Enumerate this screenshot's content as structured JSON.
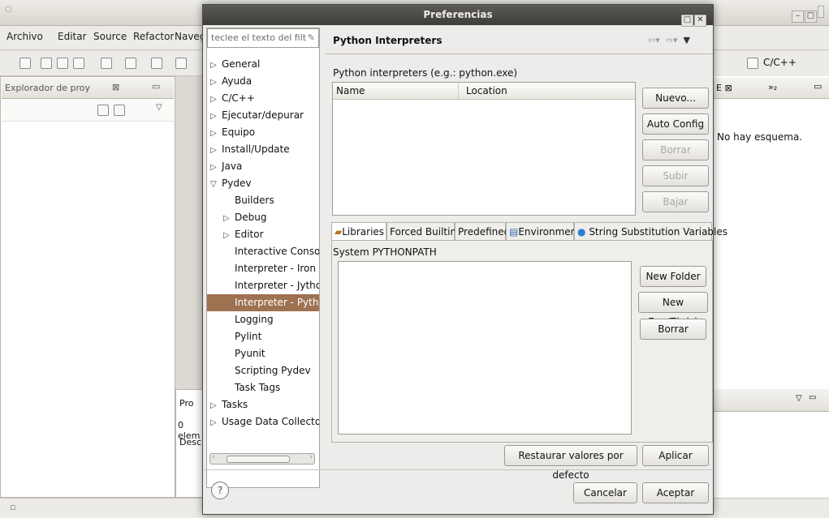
{
  "background": {
    "window_control_glyph": "○",
    "menubar": [
      "Archivo",
      "Editar",
      "Source",
      "Refactor",
      "Naveg"
    ],
    "left_view": {
      "tab_label": "Explorador de proy",
      "tab_close": "⊠"
    },
    "right_view": {
      "tab_label": "E ⊠",
      "tab_overflow": "»₂",
      "text": "No hay esquema."
    },
    "perspective": {
      "label": "C/C++"
    },
    "bottom_left": {
      "tab_label": "Pro",
      "count_text": "0 elem",
      "column": "Descr"
    }
  },
  "dialog": {
    "title": "Preferencias",
    "filter_placeholder": "teclee el texto del filt",
    "tree": [
      {
        "label": "General",
        "expander": "▷",
        "level": 0
      },
      {
        "label": "Ayuda",
        "expander": "▷",
        "level": 0
      },
      {
        "label": "C/C++",
        "expander": "▷",
        "level": 0
      },
      {
        "label": "Ejecutar/depurar",
        "expander": "▷",
        "level": 0
      },
      {
        "label": "Equipo",
        "expander": "▷",
        "level": 0
      },
      {
        "label": "Install/Update",
        "expander": "▷",
        "level": 0
      },
      {
        "label": "Java",
        "expander": "▷",
        "level": 0
      },
      {
        "label": "Pydev",
        "expander": "▽",
        "level": 0
      },
      {
        "label": "Builders",
        "expander": "",
        "level": 1
      },
      {
        "label": "Debug",
        "expander": "▷",
        "level": 1
      },
      {
        "label": "Editor",
        "expander": "▷",
        "level": 1
      },
      {
        "label": "Interactive Console",
        "expander": "",
        "level": 1
      },
      {
        "label": "Interpreter - Iron Py",
        "expander": "",
        "level": 1
      },
      {
        "label": "Interpreter - Jython",
        "expander": "",
        "level": 1
      },
      {
        "label": "Interpreter - Python",
        "expander": "",
        "level": 1,
        "selected": true
      },
      {
        "label": "Logging",
        "expander": "",
        "level": 1
      },
      {
        "label": "Pylint",
        "expander": "",
        "level": 1
      },
      {
        "label": "Pyunit",
        "expander": "",
        "level": 1
      },
      {
        "label": "Scripting Pydev",
        "expander": "",
        "level": 1
      },
      {
        "label": "Task Tags",
        "expander": "",
        "level": 1
      },
      {
        "label": "Tasks",
        "expander": "▷",
        "level": 0
      },
      {
        "label": "Usage Data Collector",
        "expander": "▷",
        "level": 0
      }
    ],
    "page_title": "Python Interpreters",
    "interpreters_label": "Python interpreters (e.g.: python.exe)",
    "table_headers": [
      "Name",
      "Location"
    ],
    "buttons": {
      "nuevo": "Nuevo...",
      "auto_config": "Auto Config",
      "borrar": "Borrar",
      "subir": "Subir",
      "bajar": "Bajar"
    },
    "tabs": [
      "Libraries",
      "Forced Builtins",
      "Predefined",
      "Environment",
      "String Substitution Variables"
    ],
    "system_path_label": "System PYTHONPATH",
    "lib_buttons": {
      "new_folder": "New Folder",
      "new_egg": "New Egg/Zip(s)",
      "borrar": "Borrar"
    },
    "restore_defaults": "Restaurar valores por defecto",
    "apply": "Aplicar",
    "cancel": "Cancelar",
    "accept": "Aceptar",
    "help_glyph": "?"
  }
}
